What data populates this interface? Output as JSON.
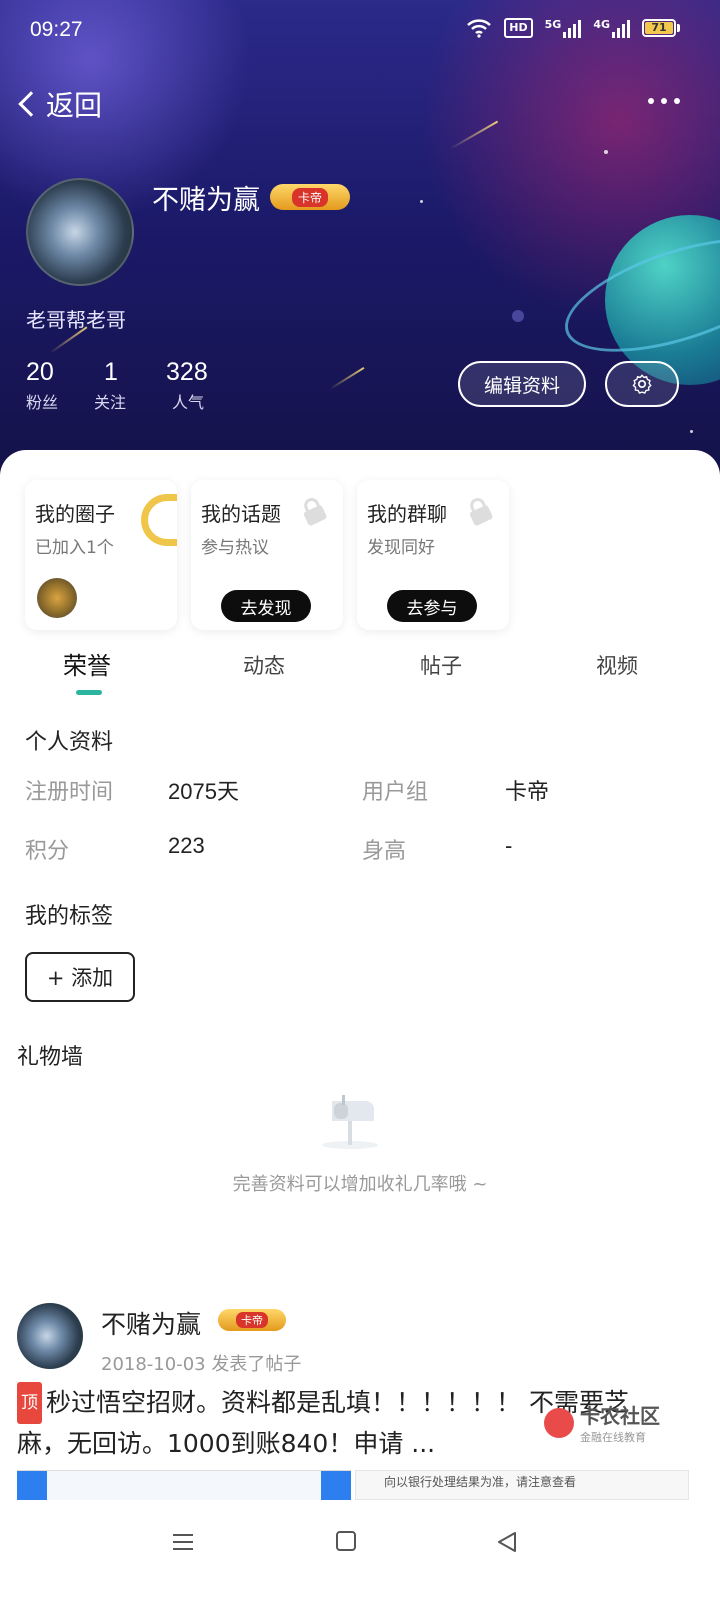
{
  "status_bar": {
    "time": "09:27",
    "hd_label": "HD",
    "net1": "5G",
    "net2": "4G",
    "battery": "71"
  },
  "nav": {
    "back_label": "返回"
  },
  "profile": {
    "username": "不赌为赢",
    "badge": "卡帝",
    "signature": "老哥帮老哥",
    "stats": [
      {
        "value": "20",
        "label": "粉丝"
      },
      {
        "value": "1",
        "label": "关注"
      },
      {
        "value": "328",
        "label": "人气"
      }
    ],
    "edit_button": "编辑资料"
  },
  "cards": [
    {
      "title": "我的圈子",
      "sub": "已加入1个"
    },
    {
      "title": "我的话题",
      "sub": "参与热议",
      "button": "去发现"
    },
    {
      "title": "我的群聊",
      "sub": "发现同好",
      "button": "去参与"
    }
  ],
  "tabs": [
    "荣誉",
    "动态",
    "帖子",
    "视频"
  ],
  "info": {
    "title": "个人资料",
    "register_label": "注册时间",
    "register_value": "2075天",
    "group_label": "用户组",
    "group_value": "卡帝",
    "points_label": "积分",
    "points_value": "223",
    "height_label": "身高",
    "height_value": "-"
  },
  "tags": {
    "title": "我的标签",
    "add_button": "+ 添加"
  },
  "gifts": {
    "title": "礼物墙",
    "empty_text": "完善资料可以增加收礼几率哦 ~"
  },
  "post": {
    "author": "不赌为赢",
    "badge": "卡帝",
    "meta": "2018-10-03  发表了帖子",
    "top_badge": "顶",
    "text": "秒过悟空招财。资料都是乱填！！！！！！ 不需要芝麻，无回访。1000到账840！申请 ...",
    "image_caption": "向以银行处理结果为准，请注意查看"
  },
  "watermark": {
    "name": "卡农社区",
    "slogan": "金融在线教育"
  }
}
